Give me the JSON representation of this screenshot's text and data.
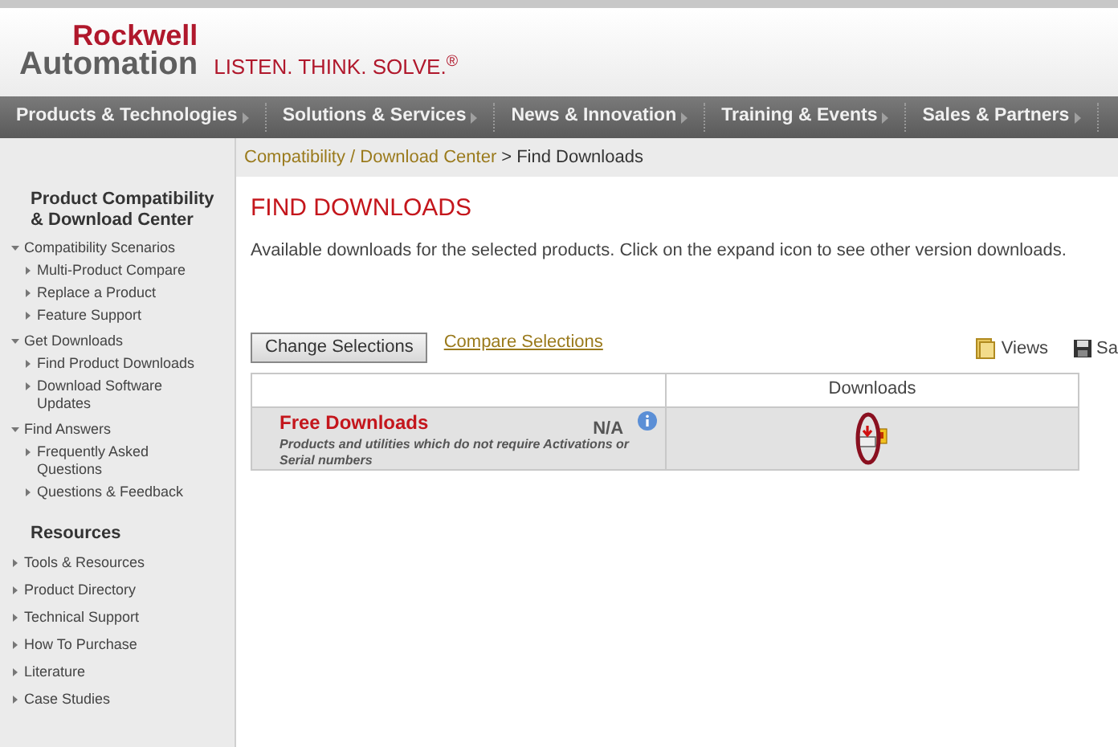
{
  "logo": {
    "line1": "Rockwell",
    "line2": "Automation",
    "tagline": "LISTEN. THINK. SOLVE.$^{®}$"
  },
  "nav": [
    {
      "label": "Products & Technologies"
    },
    {
      "label": "Solutions & Services"
    },
    {
      "label": "News & Innovation"
    },
    {
      "label": "Training & Events"
    },
    {
      "label": "Sales & Partners"
    }
  ],
  "sidebar": {
    "sections": [
      {
        "title": "Product Compatibility & Download Center",
        "items": [
          {
            "label": "Compatibility Scenarios",
            "expanded": true,
            "children": [
              {
                "label": "Multi-Product Compare"
              },
              {
                "label": "Replace a Product"
              },
              {
                "label": "Feature Support"
              }
            ]
          },
          {
            "label": "Get Downloads",
            "expanded": true,
            "children": [
              {
                "label": "Find Product Downloads"
              },
              {
                "label": "Download Software Updates"
              }
            ]
          },
          {
            "label": "Find Answers",
            "expanded": true,
            "children": [
              {
                "label": "Frequently Asked Questions"
              },
              {
                "label": "Questions & Feedback"
              }
            ]
          }
        ]
      },
      {
        "title": "Resources",
        "items": [
          {
            "label": "Tools & Resources",
            "expanded": false
          },
          {
            "label": "Product Directory",
            "expanded": false
          },
          {
            "label": "Technical Support",
            "expanded": false
          },
          {
            "label": "How To Purchase",
            "expanded": false
          },
          {
            "label": "Literature",
            "expanded": false
          },
          {
            "label": "Case Studies",
            "expanded": false
          }
        ]
      }
    ]
  },
  "breadcrumb": {
    "link": "Compatibility / Download Center",
    "separator": ">",
    "current": "Find Downloads"
  },
  "title": "FIND DOWNLOADS",
  "description": "Available downloads for the selected products. Click on the expand icon to see other version downloads.",
  "toolbar": {
    "change_button": "Change Selections",
    "compare_link": "Compare Selections",
    "views": "Views",
    "save": "Sa"
  },
  "table": {
    "column_2": "Downloads",
    "rows": [
      {
        "name": "Free Downloads",
        "version": "N/A",
        "note": "Products and utilities which do not require Activations or Serial numbers",
        "highlighted": true
      }
    ]
  }
}
